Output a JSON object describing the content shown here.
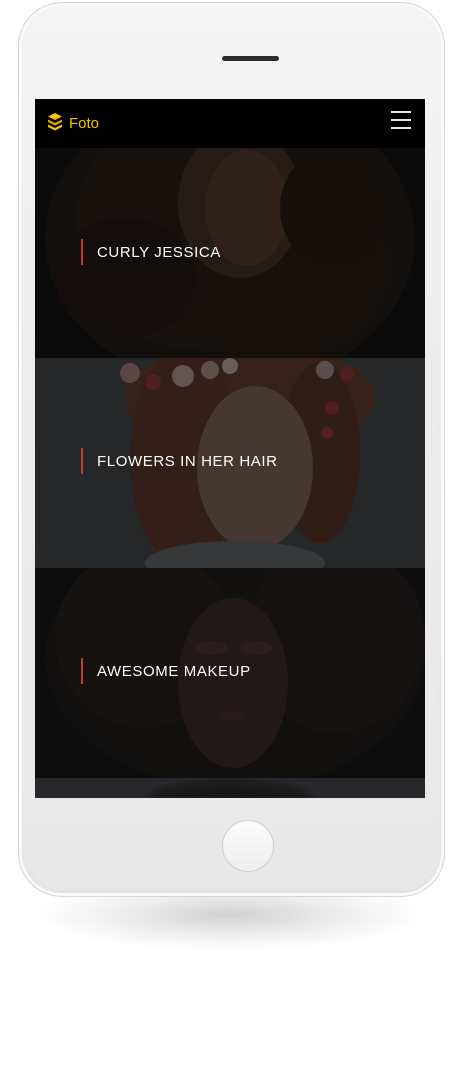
{
  "app": {
    "logo_text": "Foto",
    "logo_icon": "stacked-layers-icon",
    "menu_icon": "hamburger-menu-icon",
    "accent_color": "#f6c400",
    "marker_color": "#c0393b"
  },
  "gallery": {
    "items": [
      {
        "title": "CURLY JESSICA"
      },
      {
        "title": "FLOWERS IN HER HAIR"
      },
      {
        "title": "AWESOME MAKEUP"
      }
    ]
  }
}
